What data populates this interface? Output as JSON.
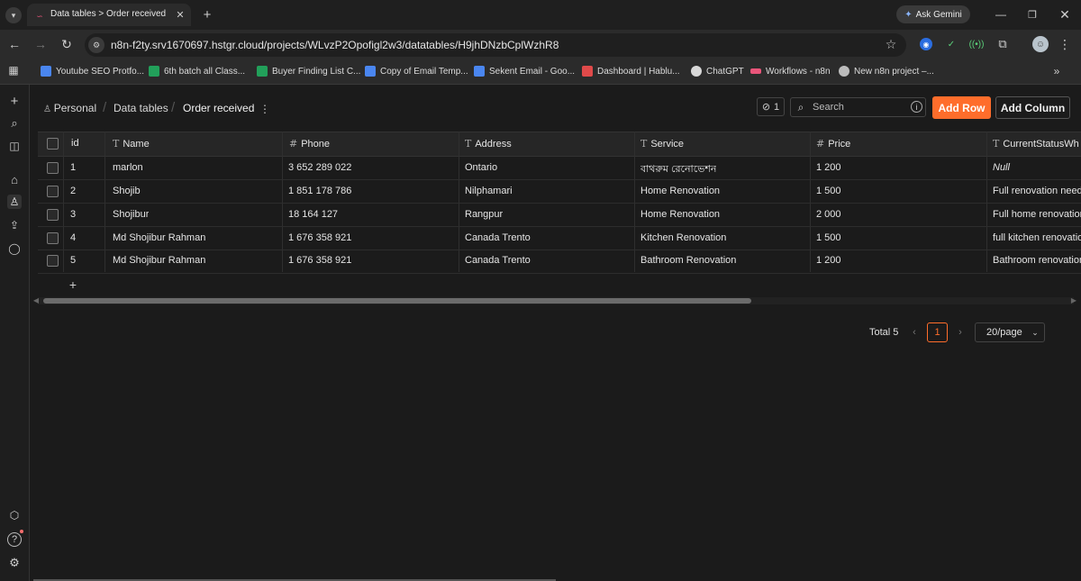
{
  "browser": {
    "tab_title": "Data tables > Order received - ",
    "url": "n8n-f2ty.srv1670697.hstgr.cloud/projects/WLvzP2Opofigl2w3/datatables/H9jhDNzbCplWzhR8",
    "ask_gemini": "Ask Gemini",
    "bookmarks": [
      {
        "label": "Youtube SEO Protfo...",
        "color": "#4a86f0"
      },
      {
        "label": "6th batch all Class...",
        "color": "#22a05a"
      },
      {
        "label": "Buyer Finding List C...",
        "color": "#22a05a"
      },
      {
        "label": "Copy of Email Temp...",
        "color": "#4a86f0"
      },
      {
        "label": "Sekent Email - Goo...",
        "color": "#4a86f0"
      },
      {
        "label": "Dashboard | Hablu...",
        "color": "#e04a4a"
      },
      {
        "label": "ChatGPT",
        "color": "#d8d8d8"
      },
      {
        "label": "Workflows - n8n",
        "color": "#e9557a"
      },
      {
        "label": "New n8n project –...",
        "color": "#bcbcbc"
      }
    ],
    "bookmarks_overflow": "»"
  },
  "breadcrumb": {
    "personal": "Personal",
    "data_tables": "Data tables",
    "current": "Order received"
  },
  "toolbar": {
    "link_count": "1",
    "search_placeholder": "Search",
    "add_row": "Add Row",
    "add_column": "Add Column"
  },
  "table": {
    "columns": [
      {
        "label": "id",
        "type": ""
      },
      {
        "label": "Name",
        "type": "T"
      },
      {
        "label": "Phone",
        "type": "#"
      },
      {
        "label": "Address",
        "type": "T"
      },
      {
        "label": "Service",
        "type": "T"
      },
      {
        "label": "Price",
        "type": "#"
      },
      {
        "label": "CurrentStatusWh",
        "type": "T"
      }
    ],
    "rows": [
      {
        "id": "1",
        "name": "marlon",
        "phone": "3 652 289 022",
        "address": "Ontario",
        "service": "বাথরুম রেনোভেশন",
        "price": "1 200",
        "status": "Null"
      },
      {
        "id": "2",
        "name": "Shojib",
        "phone": "1 851 178 786",
        "address": "Nilphamari",
        "service": "Home Renovation",
        "price": "1 500",
        "status": "Full renovation need"
      },
      {
        "id": "3",
        "name": "Shojibur",
        "phone": "18 164 127",
        "address": "Rangpur",
        "service": "Home Renovation",
        "price": "2 000",
        "status": "Full home renovation"
      },
      {
        "id": "4",
        "name": "Md Shojibur Rahman",
        "phone": "1 676 358 921",
        "address": "Canada Trento",
        "service": "Kitchen Renovation",
        "price": "1 500",
        "status": "full kitchen renovatio"
      },
      {
        "id": "5",
        "name": "Md Shojibur Rahman",
        "phone": "1 676 358 921",
        "address": "Canada Trento",
        "service": "Bathroom Renovation",
        "price": "1 200",
        "status": "Bathroom renovation"
      }
    ],
    "add_row_symbol": "+"
  },
  "pagination": {
    "total": "Total 5",
    "current_page": "1",
    "page_size": "20/page"
  },
  "colors": {
    "accent": "#ff6d2b",
    "background": "#1b1b1b"
  }
}
